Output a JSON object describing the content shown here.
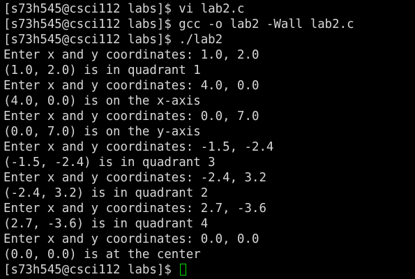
{
  "terminal": {
    "lines": [
      "[s73h545@csci112 labs]$ vi lab2.c",
      "[s73h545@csci112 labs]$ gcc -o lab2 -Wall lab2.c",
      "[s73h545@csci112 labs]$ ./lab2",
      "Enter x and y coordinates: 1.0, 2.0",
      "(1.0, 2.0) is in quadrant 1",
      "Enter x and y coordinates: 4.0, 0.0",
      "(4.0, 0.0) is on the x-axis",
      "Enter x and y coordinates: 0.0, 7.0",
      "(0.0, 7.0) is on the y-axis",
      "Enter x and y coordinates: -1.5, -2.4",
      "(-1.5, -2.4) is in quadrant 3",
      "Enter x and y coordinates: -2.4, 3.2",
      "(-2.4, 3.2) is in quadrant 2",
      "Enter x and y coordinates: 2.7, -3.6",
      "(2.7, -3.6) is in quadrant 4",
      "Enter x and y coordinates: 0.0, 0.0",
      "(0.0, 0.0) is at the center"
    ],
    "prompt": "[s73h545@csci112 labs]$ ",
    "colors": {
      "background": "#000000",
      "text": "#d8d8d8",
      "cursor": "#00e000"
    }
  }
}
